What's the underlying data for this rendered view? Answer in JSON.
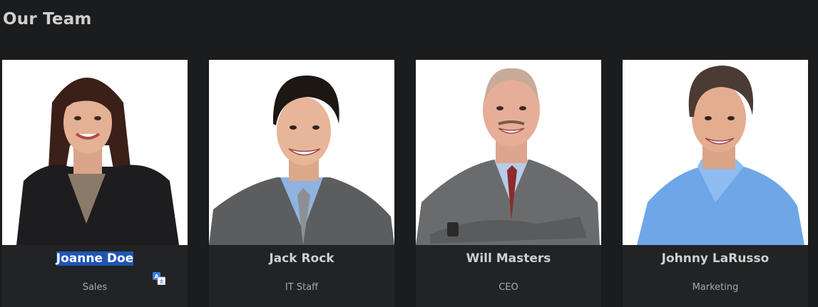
{
  "section": {
    "title": "Our Team"
  },
  "members": [
    {
      "name": "Joanne Doe",
      "role": "Sales"
    },
    {
      "name": "Jack Rock",
      "role": "IT Staff"
    },
    {
      "name": "Will Masters",
      "role": "CEO"
    },
    {
      "name": "Johnny LaRusso",
      "role": "Marketing"
    }
  ],
  "colors": {
    "background": "#1b1c1e",
    "card": "#212325",
    "selection": "#1f55b4",
    "heading": "#cfcfcf",
    "role_text": "#a9a9a9"
  },
  "icons": {
    "translate": "translate-icon"
  }
}
